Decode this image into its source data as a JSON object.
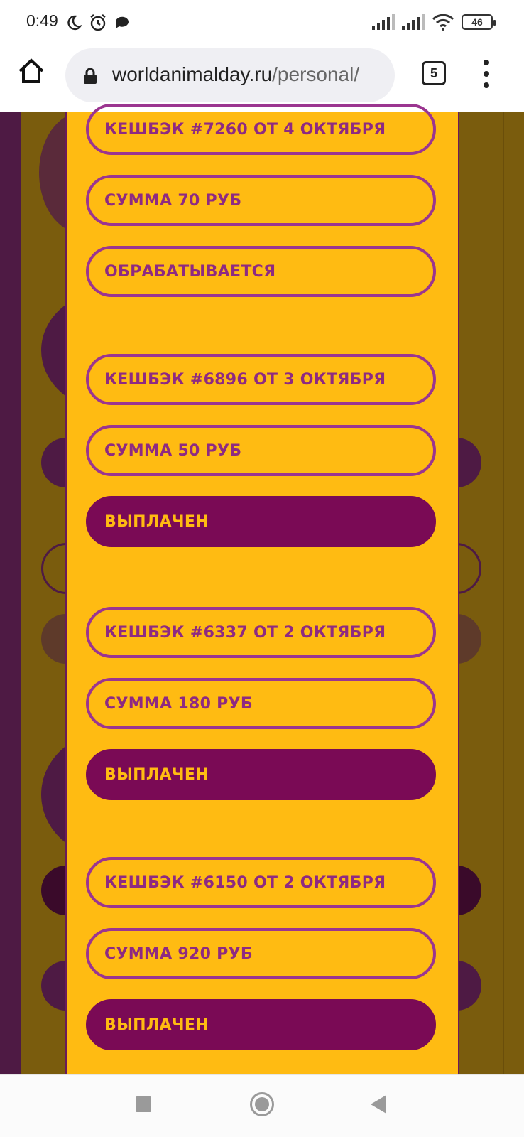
{
  "status_bar": {
    "time": "0:49",
    "battery": "46",
    "icons": [
      "moon-icon",
      "alarm-icon",
      "chat-icon",
      "signal-icon",
      "signal-icon",
      "wifi-icon",
      "battery-icon"
    ]
  },
  "browser": {
    "url_domain": "worldanimalday.ru",
    "url_path": "/personal/",
    "tab_count": "5"
  },
  "cashbacks": [
    {
      "title": "КЕШБЭК #7260 ОТ 4 ОКТЯБРЯ",
      "amount": "СУММА 70 РУБ",
      "status": "ОБРАБАТЫВАЕТСЯ",
      "status_type": "processing"
    },
    {
      "title": "КЕШБЭК #6896 ОТ 3 ОКТЯБРЯ",
      "amount": "СУММА 50 РУБ",
      "status": "ВЫПЛАЧЕН",
      "status_type": "paid"
    },
    {
      "title": "КЕШБЭК #6337 ОТ 2 ОКТЯБРЯ",
      "amount": "СУММА 180 РУБ",
      "status": "ВЫПЛАЧЕН",
      "status_type": "paid"
    },
    {
      "title": "КЕШБЭК #6150 ОТ 2 ОКТЯБРЯ",
      "amount": "СУММА 920 РУБ",
      "status": "ВЫПЛАЧЕН",
      "status_type": "paid"
    }
  ],
  "colors": {
    "modal_bg": "#ffbb12",
    "accent_purple": "#9b3590",
    "paid_fill": "#7a0a55"
  }
}
